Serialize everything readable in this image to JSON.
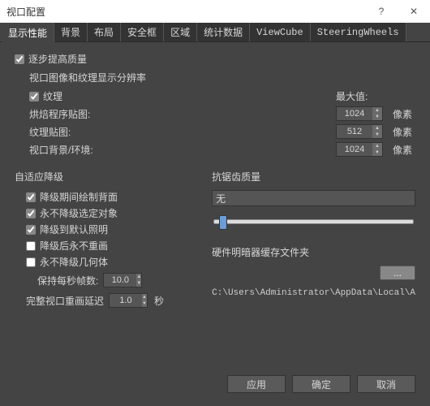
{
  "window": {
    "title": "视口配置"
  },
  "tabs": [
    "显示性能",
    "背景",
    "布局",
    "安全框",
    "区域",
    "统计数据",
    "ViewCube",
    "SteeringWheels"
  ],
  "active_tab": 0,
  "progressive": {
    "label": "逐步提高质量",
    "checked": true,
    "section_label": "视口图像和纹理显示分辨率",
    "texture_label": "纹理",
    "texture_checked": true,
    "max_label": "最大值:",
    "unit": "像素",
    "rows": [
      {
        "label": "烘焙程序贴图:",
        "value": "1024"
      },
      {
        "label": "纹理贴图:",
        "value": "512"
      },
      {
        "label": "视口背景/环境:",
        "value": "1024"
      }
    ]
  },
  "adaptive": {
    "title": "自适应降级",
    "items": [
      {
        "label": "降级期间绘制背面",
        "checked": true
      },
      {
        "label": "永不降级选定对象",
        "checked": true
      },
      {
        "label": "降级到默认照明",
        "checked": true
      },
      {
        "label": "降级后永不重画",
        "checked": false
      },
      {
        "label": "永不降级几何体",
        "checked": false
      }
    ],
    "fps_label": "保持每秒帧数:",
    "fps_value": "10.0",
    "delay_label": "完整视口重画延迟",
    "delay_value": "1.0",
    "delay_unit": "秒"
  },
  "antialias": {
    "title": "抗锯齿质量",
    "combo_value": "无"
  },
  "cache": {
    "title": "硬件明暗器缓存文件夹",
    "browse_label": "...",
    "path": "C:\\Users\\Administrator\\AppData\\Local\\A"
  },
  "buttons": {
    "apply": "应用",
    "ok": "确定",
    "cancel": "取消"
  }
}
